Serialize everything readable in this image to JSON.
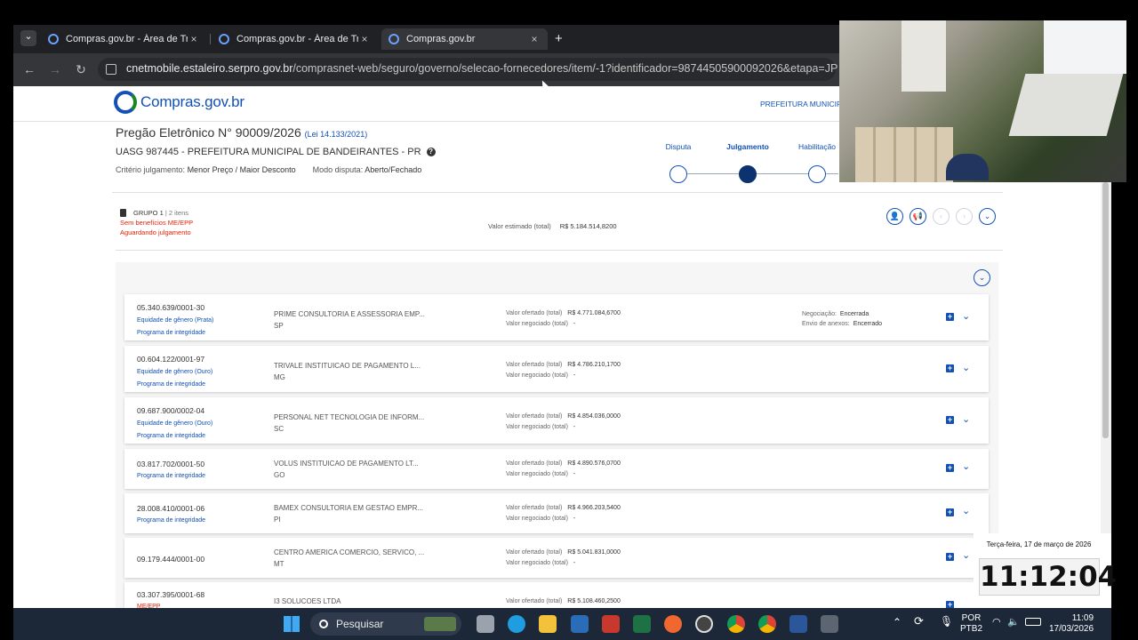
{
  "browser": {
    "tabs": [
      {
        "title": "Compras.gov.br - Área de Trabalho",
        "close": "×"
      },
      {
        "title": "Compras.gov.br - Área de Trabalho",
        "close": "×"
      },
      {
        "title": "Compras.gov.br",
        "close": "×"
      }
    ],
    "new_tab": "+",
    "tab_menu": "⌄",
    "url_host": "cnetmobile.estaleiro.serpro.gov.br",
    "url_path": "/comprasnet-web/seguro/governo/selecao-fornecedores/item/-1?identificador=98744505900092026&etapa=JP"
  },
  "site": {
    "logo_text": "Compras.gov.br",
    "org_link": "PREFEITURA MUNICIPAL"
  },
  "pregao": {
    "title": "Pregão Eletrônico N° 90009/2026",
    "law": "(Lei 14.133/2021)",
    "uasg": "UASG 987445 - PREFEITURA MUNICIPAL DE BANDEIRANTES - PR",
    "help": "?",
    "criterio_label": "Critério julgamento:",
    "criterio_value": "Menor Preço / Maior Desconto",
    "modo_label": "Modo disputa:",
    "modo_value": "Aberto/Fechado"
  },
  "steps": [
    {
      "label": "Disputa",
      "active": false
    },
    {
      "label": "Julgamento",
      "active": true
    },
    {
      "label": "Habilitação",
      "active": false
    }
  ],
  "group": {
    "name": "GRUPO 1",
    "items": "| 2 itens",
    "benefit": "Sem benefícios ME/EPP",
    "status": "Aguardando julgamento",
    "valor_label": "Valor estimado (total)",
    "valor": "R$ 5.184.514,8200"
  },
  "actions": [
    {
      "name": "user-check-icon",
      "glyph": "👤"
    },
    {
      "name": "megaphone-icon",
      "glyph": "📢"
    },
    {
      "name": "prev-icon",
      "glyph": "‹"
    },
    {
      "name": "next-icon",
      "glyph": "›"
    },
    {
      "name": "expand-icon",
      "glyph": "⌄"
    }
  ],
  "expand_all": "⌄",
  "labels": {
    "ofertado": "Valor ofertado (total)",
    "negociado": "Valor negociado (total)",
    "negociacao": "Negociação:",
    "anexos": "Envio de anexos:"
  },
  "suppliers": [
    {
      "cnpj": "05.340.639/0001-30",
      "tags": [
        "Equidade de gênero (Prata)",
        "Programa de integridade"
      ],
      "name": "PRIME CONSULTORIA E ASSESSORIA EMP...",
      "uf": "SP",
      "ofertado": "R$ 4.771.084,6700",
      "negociado": "-",
      "negociacao": "Encerrada",
      "anexos": "Encerrado"
    },
    {
      "cnpj": "00.604.122/0001-97",
      "tags": [
        "Equidade de gênero (Ouro)",
        "Programa de integridade"
      ],
      "name": "TRIVALE INSTITUICAO DE PAGAMENTO L...",
      "uf": "MG",
      "ofertado": "R$ 4.786.210,1700",
      "negociado": "-"
    },
    {
      "cnpj": "09.687.900/0002-04",
      "tags": [
        "Equidade de gênero (Ouro)",
        "Programa de integridade"
      ],
      "name": "PERSONAL NET TECNOLOGIA DE INFORM...",
      "uf": "SC",
      "ofertado": "R$ 4.854.036,0000",
      "negociado": "-"
    },
    {
      "cnpj": "03.817.702/0001-50",
      "tags": [
        "Programa de integridade"
      ],
      "name": "VOLUS INSTITUICAO DE PAGAMENTO LT...",
      "uf": "GO",
      "ofertado": "R$ 4.890.576,0700",
      "negociado": "-"
    },
    {
      "cnpj": "28.008.410/0001-06",
      "tags": [
        "Programa de integridade"
      ],
      "name": "BAMEX CONSULTORIA EM GESTAO EMPR...",
      "uf": "PI",
      "ofertado": "R$ 4.966.203,5400",
      "negociado": "-"
    },
    {
      "cnpj": "09.179.444/0001-00",
      "tags": [],
      "name": "CENTRO AMERICA COMERCIO, SERVICO, ...",
      "uf": "MT",
      "ofertado": "R$ 5.041.831,0000",
      "negociado": "-"
    },
    {
      "cnpj": "03.307.395/0001-68",
      "tags": [
        "ME/EPP"
      ],
      "name": "I3 SOLUCOES LTDA",
      "uf": "",
      "ofertado": "R$ 5.108.460,2500",
      "negociado": ""
    }
  ],
  "overlay": {
    "date": "Terça-feira, 17 de março de 2026",
    "clock": "11:12:04"
  },
  "taskbar": {
    "search": "Pesquisar",
    "lang1": "POR",
    "lang2": "PTB2",
    "time": "11:09",
    "date": "17/03/2026"
  }
}
